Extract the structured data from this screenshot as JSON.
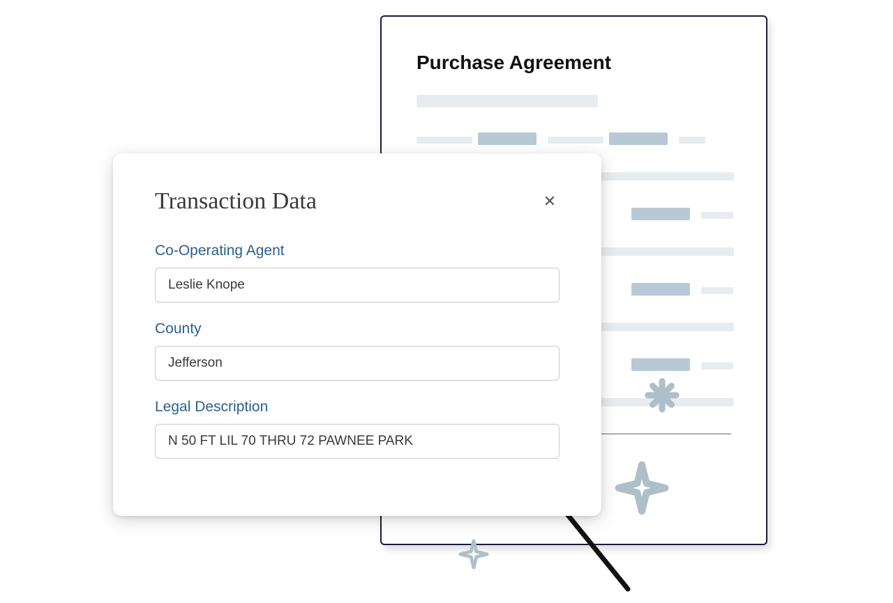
{
  "document": {
    "title": "Purchase Agreement"
  },
  "modal": {
    "title": "Transaction Data",
    "close_glyph": "✕",
    "fields": {
      "agent": {
        "label": "Co-Operating Agent",
        "value": "Leslie Knope"
      },
      "county": {
        "label": "County",
        "value": "Jefferson"
      },
      "legal": {
        "label": "Legal Description",
        "value": "N 50 FT LIL 70 THRU 72 PAWNEE PARK"
      }
    }
  }
}
